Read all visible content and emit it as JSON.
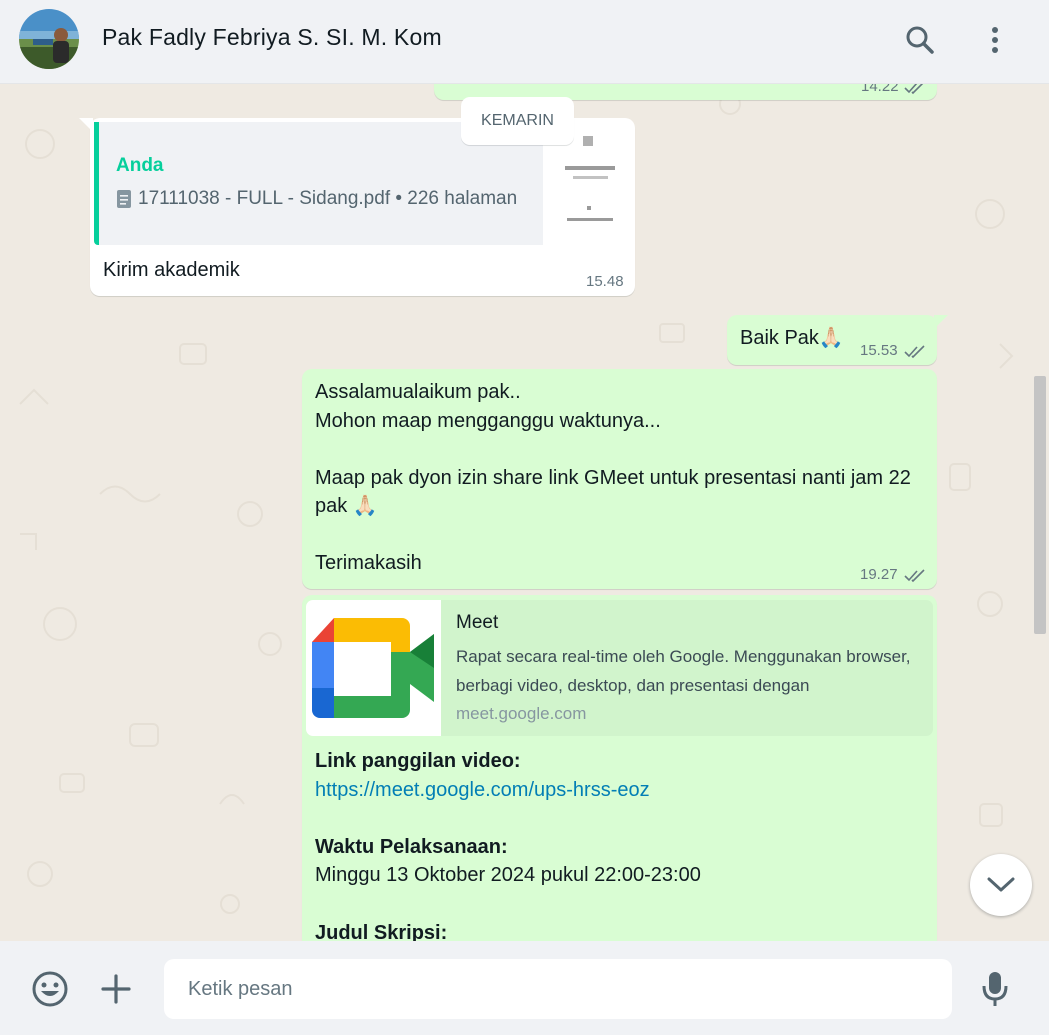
{
  "header": {
    "contact_name": "Pak Fadly Febriya S. SI. M. Kom",
    "icons": [
      "search-icon",
      "menu-dots-icon"
    ]
  },
  "chat": {
    "date_divider": "KEMARIN",
    "partial_top_message": {
      "time": "14.22",
      "ticks": "double-check-icon"
    },
    "reply_message": {
      "quoted_author": "Anda",
      "quoted_document": "17111038 - FULL - Sidang.pdf • 226 halaman",
      "text": "Kirim akademik",
      "time": "15.48"
    },
    "message_baik": {
      "text": "Baik Pak🙏🏻",
      "time": "15.53"
    },
    "message_assalamualaikum": {
      "text": "Assalamualaikum pak..\nMohon maap mengganggu waktunya...\n\nMaap pak dyon izin share link GMeet untuk presentasi nanti jam 22 pak 🙏🏻\n\nTerimakasih",
      "time": "19.27"
    },
    "message_meet": {
      "preview_title": "Meet",
      "preview_description": "Rapat secara real-time oleh Google. Menggunakan browser, berbagi video, desktop, dan presentasi dengan",
      "preview_domain": "meet.google.com",
      "link_label": "Link panggilan video:",
      "link_url": "https://meet.google.com/ups-hrss-eoz",
      "time_label": "Waktu Pelaksanaan:",
      "time_value": "Minggu 13 Oktober 2024 pukul 22:00-23:00",
      "title_label": "Judul Skripsi:"
    }
  },
  "footer": {
    "input_placeholder": "Ketik pesan",
    "icons": [
      "emoji-icon",
      "plus-icon",
      "microphone-icon"
    ]
  },
  "colors": {
    "outgoing_bubble": "#d9fdd3",
    "incoming_bubble": "#ffffff",
    "chat_background": "#efeae2",
    "accent_green": "#06cf9c",
    "link": "#027eb5"
  }
}
